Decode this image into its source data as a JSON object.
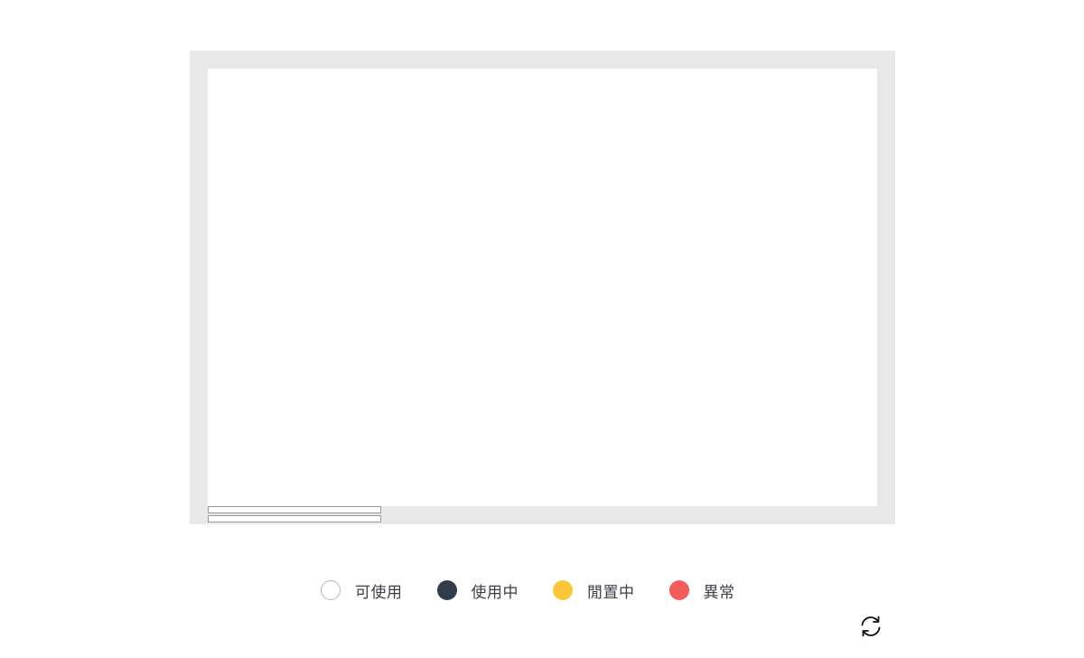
{
  "legend": {
    "items": [
      {
        "label": "可使用",
        "color": "#ffffff",
        "border": "#b5b5b5"
      },
      {
        "label": "使用中",
        "color": "#333c4a",
        "border": "#333c4a"
      },
      {
        "label": "閒置中",
        "color": "#fcc53a",
        "border": "#fcc53a"
      },
      {
        "label": "異常",
        "color": "#f45b5b",
        "border": "#f45b5b"
      }
    ]
  },
  "colors": {
    "wall": "#e8e8e8",
    "floor": "#ffffff",
    "legend_text": "#3a4048"
  },
  "icons": {
    "refresh": "refresh-icon"
  }
}
